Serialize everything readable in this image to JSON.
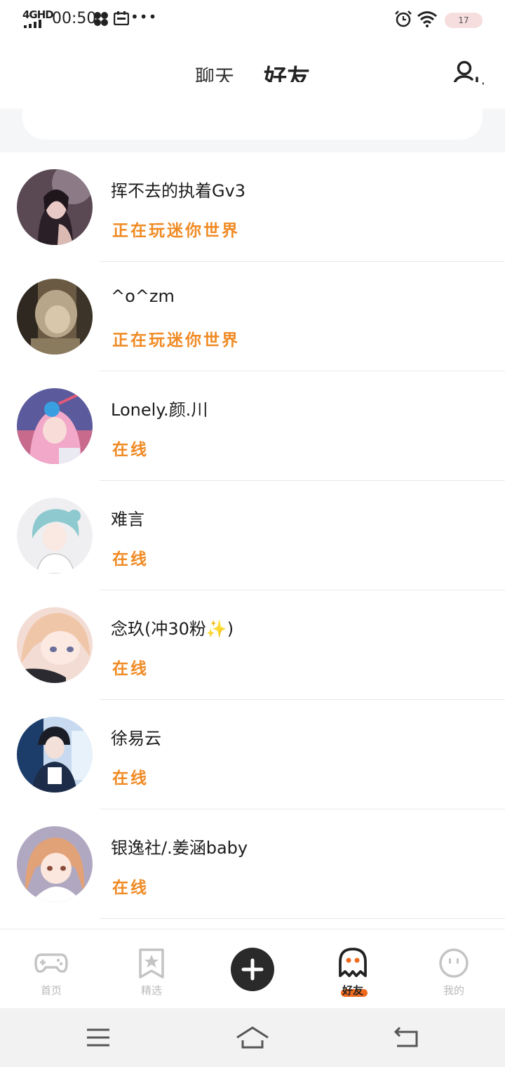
{
  "status_bar": {
    "network": "4GHD",
    "time": "00:50",
    "more": "•••",
    "battery": "17"
  },
  "header": {
    "tabs": [
      {
        "label": "聊天",
        "active": false
      },
      {
        "label": "好友",
        "active": true
      }
    ],
    "add_friend_icon": "add-user-icon",
    "accent_color": "#f06a1e"
  },
  "friends": [
    {
      "name": "挥不去的执着Gv3",
      "status": "正在玩迷你世界"
    },
    {
      "name": "^o^zm",
      "status": "正在玩迷你世界"
    },
    {
      "name": "Lonely.颜.川",
      "status": "在线"
    },
    {
      "name": "难言",
      "status": "在线"
    },
    {
      "name": "念玖(冲30粉✨)",
      "status": "在线"
    },
    {
      "name": "徐易云",
      "status": "在线"
    },
    {
      "name": "银逸社/.姜涵baby",
      "status": "在线"
    }
  ],
  "status_color": "#f08a24",
  "bottom_nav": {
    "items": [
      {
        "label": "首页",
        "icon": "gamepad-icon",
        "active": false
      },
      {
        "label": "精选",
        "icon": "star-bookmark-icon",
        "active": false
      },
      {
        "label": "",
        "icon": "plus-icon",
        "active": false
      },
      {
        "label": "好友",
        "icon": "ghost-icon",
        "active": true
      },
      {
        "label": "我的",
        "icon": "face-icon",
        "active": false
      }
    ]
  },
  "system_nav": {
    "icons": [
      "menu-icon",
      "home-icon",
      "back-icon"
    ]
  }
}
